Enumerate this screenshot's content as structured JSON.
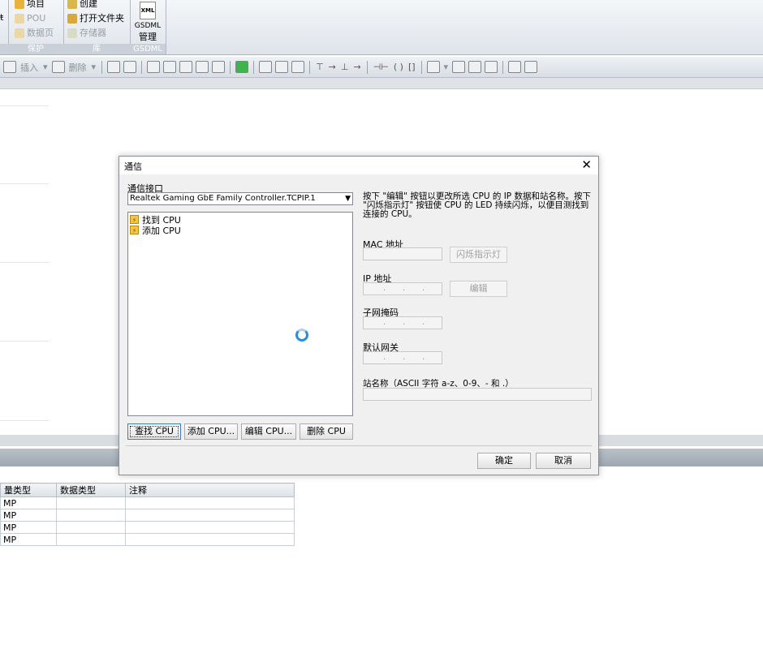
{
  "ribbon": {
    "col0": {
      "fragment": "ŧ"
    },
    "protect": {
      "items": [
        "项目",
        "POU",
        "数据页"
      ],
      "group_label": "保护"
    },
    "library": {
      "items": [
        "创建",
        "打开文件夹",
        "存储器"
      ],
      "group_label": "库"
    },
    "gsdml": {
      "icon_text": "XML",
      "label_line1": "GSDML",
      "label_line2": "管理",
      "group_label": "GSDML"
    }
  },
  "toolbar": {
    "insert_label": "插入",
    "delete_label": "删除"
  },
  "var_table": {
    "headers": [
      "量类型",
      "数据类型",
      "注释"
    ],
    "rows": [
      [
        "MP",
        "",
        ""
      ],
      [
        "MP",
        "",
        ""
      ],
      [
        "MP",
        "",
        ""
      ],
      [
        "MP",
        "",
        ""
      ]
    ]
  },
  "dialog": {
    "title": "通信",
    "interface_label": "通信接口",
    "interface_value": "Realtek Gaming GbE Family Controller.TCPIP.1",
    "tree_items": [
      "找到 CPU",
      "添加 CPU"
    ],
    "description": "按下 \"编辑\" 按钮以更改所选 CPU 的 IP 数据和站名称。按下 \"闪烁指示灯\" 按钮使 CPU 的 LED 持续闪烁，以便目测找到连接的 CPU。",
    "mac_label": "MAC 地址",
    "blink_button": "闪烁指示灯",
    "ip_label": "IP 地址",
    "edit_button": "编辑",
    "subnet_label": "子网掩码",
    "gateway_label": "默认网关",
    "station_label": "站名称（ASCII 字符 a-z、0-9、- 和 .）",
    "buttons": {
      "find": "查找 CPU",
      "add": "添加 CPU...",
      "edit": "编辑 CPU...",
      "delete": "删除 CPU"
    },
    "ok": "确定",
    "cancel": "取消"
  },
  "colors": {
    "accent": "#2b8ce0",
    "ribbon_group": "#c9d0d8"
  }
}
